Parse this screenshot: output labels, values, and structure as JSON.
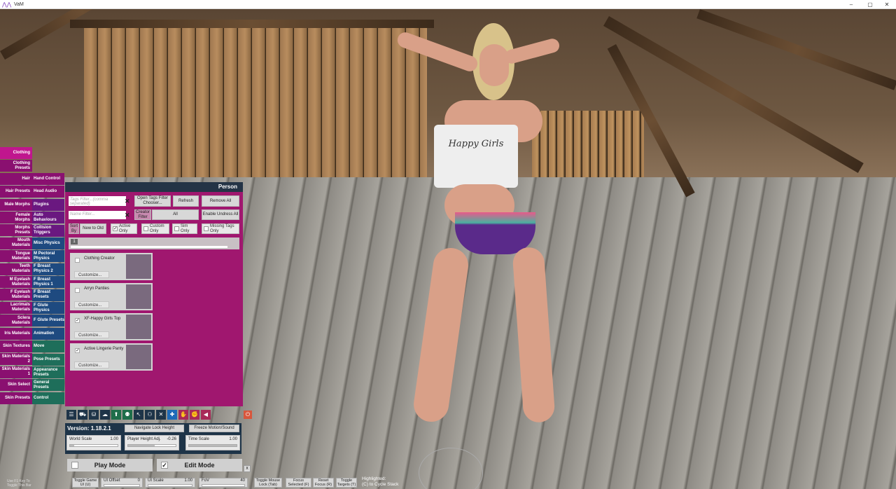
{
  "window": {
    "title": "VaM",
    "minimize": "–",
    "maximize": "▢",
    "close": "✕"
  },
  "left_tabs": [
    {
      "label": "Clothing",
      "selected": true
    },
    {
      "label": "Clothing Presets"
    },
    {
      "label": "Hair"
    },
    {
      "label": "Hair Presets"
    },
    {
      "label": "Male Morphs"
    },
    {
      "label": "Female Morphs"
    },
    {
      "label": "Morphs Presets"
    },
    {
      "label": "Mouth Materials"
    },
    {
      "label": "Tongue Materials"
    },
    {
      "label": "Teeth Materials"
    },
    {
      "label": "M Eyelash Materials"
    },
    {
      "label": "F Eyelash Materials"
    },
    {
      "label": "Lacrimals Materials"
    },
    {
      "label": "Sclera Materials"
    },
    {
      "label": "Iris Materials"
    },
    {
      "label": "Skin Textures"
    },
    {
      "label": "Skin Materials 2"
    },
    {
      "label": "Skin Materials 1"
    },
    {
      "label": "Skin Select"
    },
    {
      "label": "Skin Presets"
    }
  ],
  "right_tabs": [
    {
      "label": "Hand Control",
      "color": "#8a1070"
    },
    {
      "label": "Head Audio",
      "color": "#8a1070"
    },
    {
      "label": "Plugins",
      "color": "#6a1880"
    },
    {
      "label": "Auto Behaviours",
      "color": "#6a1880"
    },
    {
      "label": "Collision Triggers",
      "color": "#6a1880"
    },
    {
      "label": "Misc Physics",
      "color": "#1e4a80"
    },
    {
      "label": "M Pectoral Physics",
      "color": "#1e4a80"
    },
    {
      "label": "F Breast Physics 2",
      "color": "#1e4a80"
    },
    {
      "label": "F Breast Physics 1",
      "color": "#1e4a80"
    },
    {
      "label": "F Breast Presets",
      "color": "#1e4a80"
    },
    {
      "label": "F Glute Physics",
      "color": "#1e4a80"
    },
    {
      "label": "F Glute Presets",
      "color": "#1e4a80"
    },
    {
      "label": "Animation",
      "color": "#1e4a80"
    },
    {
      "label": "Move",
      "color": "#1e6e5a"
    },
    {
      "label": "Pose Presets",
      "color": "#1e6e5a"
    },
    {
      "label": "Appearance Presets",
      "color": "#1e6e5a"
    },
    {
      "label": "General Presets",
      "color": "#1e6e5a"
    },
    {
      "label": "Control",
      "color": "#1e6e5a"
    }
  ],
  "panel": {
    "title": "Person",
    "tags_filter_placeholder": "Tags Filter...(comma separated)",
    "name_filter_placeholder": "Name Filter...",
    "clear": "✕",
    "open_tags": "Open Tags Filter Chooser...",
    "refresh": "Refresh",
    "remove_all": "Remove All",
    "creator_filter": "Creator Filter",
    "all": "All",
    "enable_undress": "Enable Undress All",
    "sort_by": "Sort By",
    "sort_value": "New to Old",
    "active_only": "Active Only",
    "custom_only": "Custom Only",
    "sim_only": "Sim Only",
    "missing_tags": "Missing Tags Only",
    "page": "1",
    "customize": "Customize...",
    "items": [
      {
        "name": "Clothing Creator",
        "checked": false
      },
      {
        "name": "Arryn Panties",
        "checked": false
      },
      {
        "name": "XF-Happy Girls Top",
        "checked": true
      },
      {
        "name": "Active Lingerie Panty",
        "checked": true
      }
    ]
  },
  "toolbar": {
    "icons": [
      "menu-icon",
      "open-scene-icon",
      "save-scene-icon",
      "load-icon",
      "add-atom-icon",
      "person-icon",
      "select-icon",
      "people-icon",
      "tools-icon",
      "move-icon",
      "hand-icon",
      "grab-icon",
      "play-icon"
    ],
    "glyphs": [
      "☰",
      "⛟",
      "⛁",
      "☁",
      "⬆",
      "⚉",
      "↖",
      "⚇",
      "✕",
      "✚",
      "✋",
      "✊",
      "◀"
    ],
    "power": "⏻"
  },
  "version_panel": {
    "version": "Version: 1.18.2.1",
    "navigate_lock": "Navigate Lock Height",
    "freeze": "Freeze Motion/Sound",
    "world_scale_label": "World Scale",
    "world_scale_value": "1.00",
    "player_height_label": "Player Height Adj.",
    "player_height_value": "-0.26",
    "time_scale_label": "Time Scale",
    "time_scale_value": "1.00"
  },
  "modes": {
    "play": "Play Mode",
    "edit": "Edit Mode",
    "close": "x",
    "check": "✓"
  },
  "bottom": {
    "hint": "Use F1 Key To Toggle This Bar",
    "toggle_game_ui": "Toggle Game UI (U)",
    "ui_offset_label": "UI Offset",
    "ui_offset_value": "0",
    "ui_scale_label": "UI Scale",
    "ui_scale_value": "1.00",
    "fov_label": "FoV",
    "fov_value": "40",
    "toggle_mouse_lock": "Toggle Mouse Lock (Tab)",
    "focus_selected": "Focus Selected (F)",
    "reset_focus": "Reset Focus (R)",
    "toggle_targets": "Toggle Targets (T)",
    "highlighted": "Highlighted:",
    "cycle_stack": "(C) to Cycle Stack"
  },
  "scene_text": {
    "shirt": "Happy Girls"
  }
}
